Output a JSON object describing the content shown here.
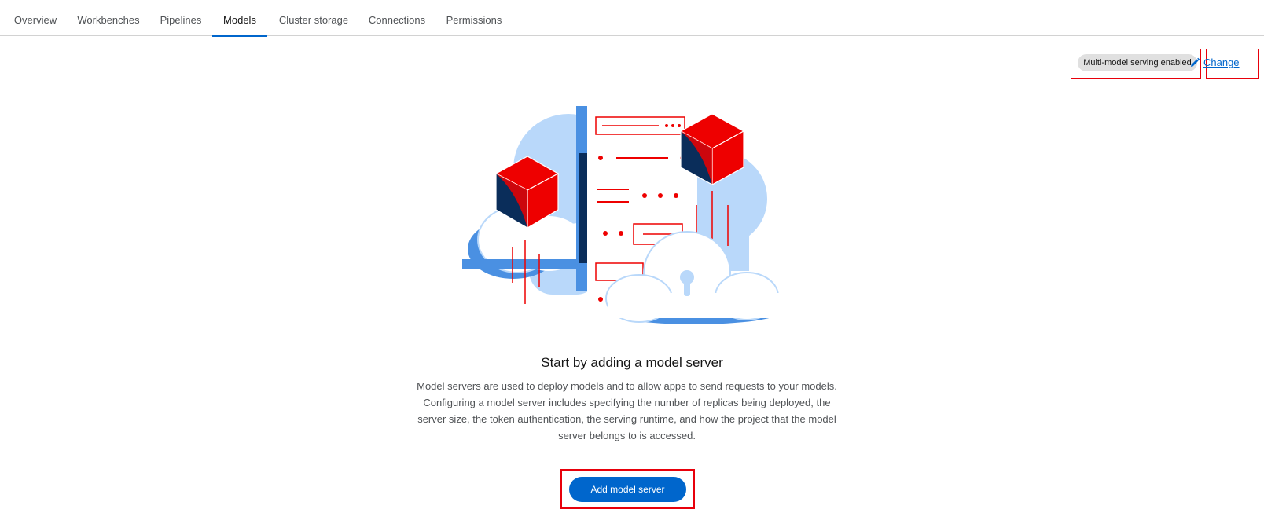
{
  "tabs": [
    {
      "label": "Overview"
    },
    {
      "label": "Workbenches"
    },
    {
      "label": "Pipelines"
    },
    {
      "label": "Models",
      "active": true
    },
    {
      "label": "Cluster storage"
    },
    {
      "label": "Connections"
    },
    {
      "label": "Permissions"
    }
  ],
  "serving": {
    "badge_label": "Multi-model serving enabled",
    "change_label": "Change",
    "change_icon": "pencil-icon"
  },
  "empty_state": {
    "illustration_icon": "cloud-model-server-illustration",
    "title": "Start by adding a model server",
    "description": "Model servers are used to deploy models and to allow apps to send requests to your models. Configuring a model server includes specifying the number of replicas being deployed, the server size, the token authentication, the serving runtime, and how the project that the model server belongs to is accessed.",
    "primary_button_label": "Add model server"
  },
  "colors": {
    "accent": "#0066cc",
    "highlight": "#e8000b",
    "badge_bg": "#e0e0e0"
  }
}
